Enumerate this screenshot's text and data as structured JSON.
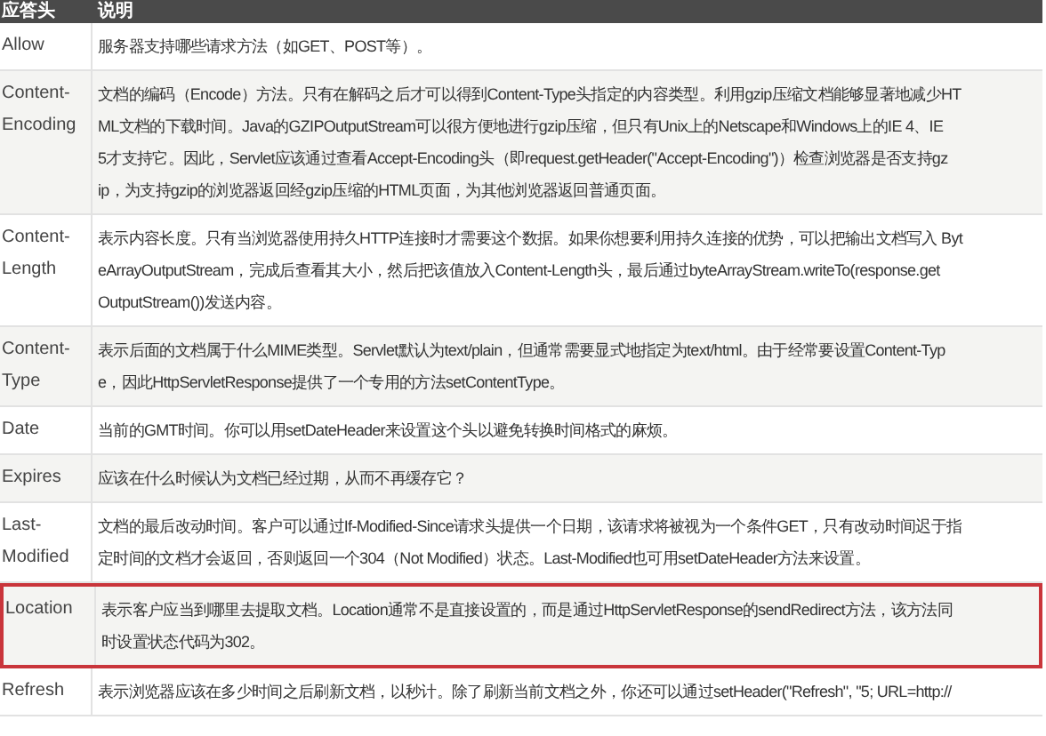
{
  "table": {
    "columns": [
      "应答头",
      "说明"
    ],
    "rows": [
      {
        "header": [
          "Allow"
        ],
        "lines": [
          "服务器支持哪些请求方法（如GET、POST等）。"
        ],
        "highlighted": false
      },
      {
        "header": [
          "Content-",
          "Encoding"
        ],
        "lines": [
          "文档的编码（Encode）方法。只有在解码之后才可以得到Content-Type头指定的内容类型。利用gzip压缩文档能够显著地减少HT",
          "ML文档的下载时间。Java的GZIPOutputStream可以很方便地进行gzip压缩，但只有Unix上的Netscape和Windows上的IE 4、IE",
          "5才支持它。因此，Servlet应该通过查看Accept-Encoding头（即request.getHeader(\"Accept-Encoding\")）检查浏览器是否支持gz",
          "ip，为支持gzip的浏览器返回经gzip压缩的HTML页面，为其他浏览器返回普通页面。"
        ],
        "highlighted": false
      },
      {
        "header": [
          "Content-",
          "Length"
        ],
        "lines": [
          "表示内容长度。只有当浏览器使用持久HTTP连接时才需要这个数据。如果你想要利用持久连接的优势，可以把输出文档写入 Byt",
          "eArrayOutputStream，完成后查看其大小，然后把该值放入Content-Length头，最后通过byteArrayStream.writeTo(response.get",
          "OutputStream())发送内容。"
        ],
        "highlighted": false
      },
      {
        "header": [
          "Content-",
          "Type"
        ],
        "lines": [
          "表示后面的文档属于什么MIME类型。Servlet默认为text/plain，但通常需要显式地指定为text/html。由于经常要设置Content-Typ",
          "e，因此HttpServletResponse提供了一个专用的方法setContentType。"
        ],
        "highlighted": false
      },
      {
        "header": [
          "Date"
        ],
        "lines": [
          "当前的GMT时间。你可以用setDateHeader来设置这个头以避免转换时间格式的麻烦。"
        ],
        "highlighted": false
      },
      {
        "header": [
          "Expires"
        ],
        "lines": [
          "应该在什么时候认为文档已经过期，从而不再缓存它？"
        ],
        "highlighted": false
      },
      {
        "header": [
          "Last-",
          "Modified"
        ],
        "lines": [
          "文档的最后改动时间。客户可以通过If-Modified-Since请求头提供一个日期，该请求将被视为一个条件GET，只有改动时间迟于指",
          "定时间的文档才会返回，否则返回一个304（Not Modified）状态。Last-Modified也可用setDateHeader方法来设置。"
        ],
        "highlighted": false
      },
      {
        "header": [
          "Location"
        ],
        "lines": [
          "表示客户应当到哪里去提取文档。Location通常不是直接设置的，而是通过HttpServletResponse的sendRedirect方法，该方法同",
          "时设置状态代码为302。"
        ],
        "highlighted": true
      },
      {
        "header": [
          "Refresh"
        ],
        "lines": [
          "表示浏览器应该在多少时间之后刷新文档，以秒计。除了刷新当前文档之外，你还可以通过setHeader(\"Refresh\", \"5; URL=http://"
        ],
        "highlighted": false
      }
    ]
  }
}
